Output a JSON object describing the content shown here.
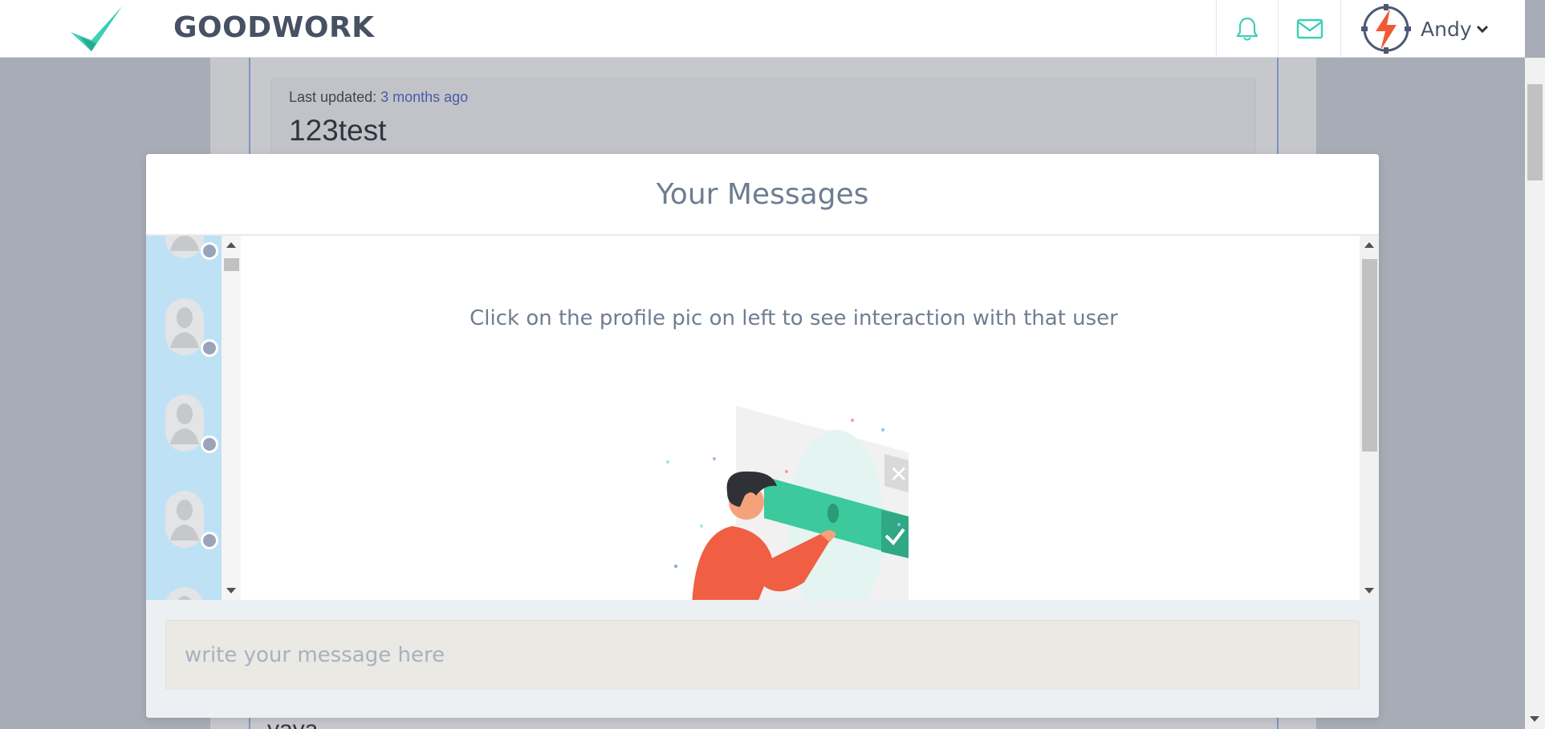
{
  "brand": {
    "name": "GOODWORK",
    "logo_icon": "checkmark-logo-icon",
    "logo_color": "#3ecfb6"
  },
  "nav": {
    "notifications_icon": "bell-icon",
    "messages_icon": "envelope-icon",
    "icon_color": "#3ecfb6",
    "user": {
      "name": "Andy",
      "avatar_icon": "lightning-badge-icon",
      "menu_icon": "chevron-down-icon"
    }
  },
  "background_page": {
    "last_updated_label": "Last updated:",
    "last_updated_value": "3 months ago",
    "card_title": "123test",
    "next_text": "yaya"
  },
  "modal": {
    "title": "Your Messages",
    "hint": "Click on the profile pic on left to see interaction with that user",
    "contact_avatar_icon": "user-placeholder-icon",
    "contact_status_color": "#99a4b8",
    "contact_column_color": "#bee1f5",
    "illustration": "person-verifying-checkmark-illustration",
    "composer": {
      "placeholder": "write your message here",
      "value": ""
    }
  }
}
